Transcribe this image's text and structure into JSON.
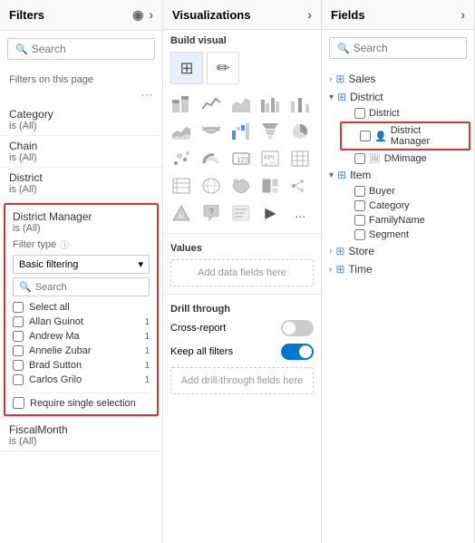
{
  "filters": {
    "title": "Filters",
    "search_placeholder": "Search",
    "section_label": "Filters on this page",
    "items": [
      {
        "name": "Category",
        "value": "is (All)"
      },
      {
        "name": "Chain",
        "value": "is (All)"
      },
      {
        "name": "District",
        "value": "is (All)"
      }
    ],
    "highlighted_filter": {
      "name": "District Manager",
      "value": "is (All)",
      "filter_type_label": "Filter type",
      "filter_type_value": "Basic filtering",
      "search_placeholder": "Search",
      "select_all": "Select all",
      "options": [
        {
          "label": "Allan Guinot",
          "count": "1"
        },
        {
          "label": "Andrew Ma",
          "count": "1"
        },
        {
          "label": "Annelie Zubar",
          "count": "1"
        },
        {
          "label": "Brad Sutton",
          "count": "1"
        },
        {
          "label": "Carlos Grilo",
          "count": "1"
        }
      ],
      "require_single": "Require single selection"
    },
    "below_item": {
      "name": "FiscalMonth",
      "value": "is (All)"
    }
  },
  "visualizations": {
    "title": "Visualizations",
    "build_visual_label": "Build visual",
    "values_label": "Values",
    "add_data_fields": "Add data fields here",
    "drill_through_label": "Drill through",
    "cross_report_label": "Cross-report",
    "cross_report_toggle": "off",
    "keep_filters_label": "Keep all filters",
    "keep_filters_toggle": "on",
    "add_drill_fields": "Add drill-through fields here",
    "more_label": "..."
  },
  "fields": {
    "title": "Fields",
    "search_placeholder": "Search",
    "groups": [
      {
        "name": "Sales",
        "icon": "table",
        "expanded": false,
        "items": []
      },
      {
        "name": "District",
        "icon": "table",
        "expanded": true,
        "subgroups": [
          {
            "items": [
              {
                "label": "District",
                "icon": "field",
                "highlighted": false
              },
              {
                "label": "District Manager",
                "icon": "person",
                "highlighted": true
              },
              {
                "label": "DMimage",
                "icon": "image",
                "highlighted": false
              }
            ]
          }
        ]
      },
      {
        "name": "Item",
        "icon": "table",
        "expanded": true,
        "items": [
          {
            "label": "Buyer",
            "icon": "field"
          },
          {
            "label": "Category",
            "icon": "field"
          },
          {
            "label": "FamilyName",
            "icon": "field"
          },
          {
            "label": "Segment",
            "icon": "field"
          }
        ]
      },
      {
        "name": "Store",
        "icon": "table",
        "expanded": false,
        "items": []
      },
      {
        "name": "Time",
        "icon": "table",
        "expanded": false,
        "items": []
      }
    ]
  },
  "icons": {
    "filter": "▽",
    "eye": "👁",
    "arrow_right": "›",
    "chevron_down": "▾",
    "chevron_right": "›",
    "search": "🔍",
    "info": "ⓘ",
    "more": "⋯",
    "table": "⊞",
    "person": "👤",
    "image": "🖼",
    "check": "✓"
  }
}
